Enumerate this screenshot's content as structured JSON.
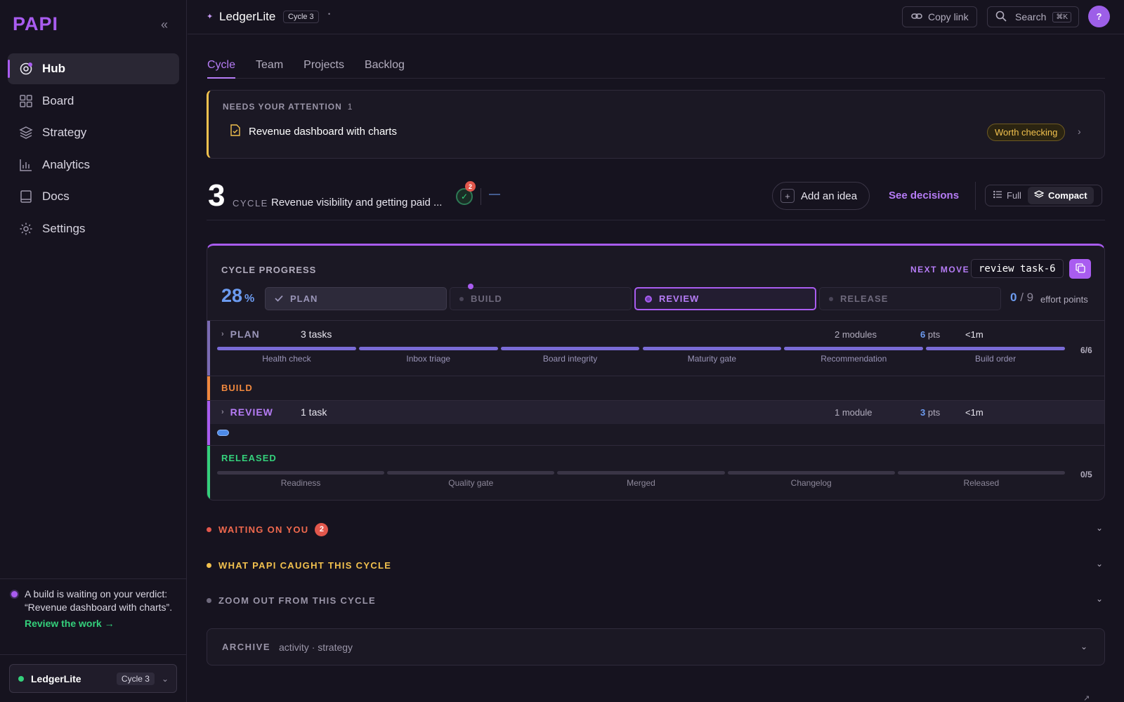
{
  "sidebar": {
    "logo": "PAPI",
    "items": [
      {
        "label": "Hub",
        "icon": "hub-icon",
        "active": true
      },
      {
        "label": "Board",
        "icon": "grid-icon"
      },
      {
        "label": "Strategy",
        "icon": "layers-icon"
      },
      {
        "label": "Analytics",
        "icon": "bar-chart-icon"
      },
      {
        "label": "Docs",
        "icon": "book-icon"
      },
      {
        "label": "Settings",
        "icon": "gear-icon"
      }
    ],
    "notice": {
      "text": "A build is waiting on your verdict: “Revenue dashboard with charts”.",
      "link": "Review the work →"
    },
    "project": {
      "name": "LedgerLite",
      "cycle": "Cycle 3"
    }
  },
  "topbar": {
    "project": "LedgerLite",
    "cycle": "Cycle 3",
    "copy_link": "Copy link",
    "search": "Search",
    "search_shortcut": "⌘K",
    "help": "?"
  },
  "tabs": [
    "Cycle",
    "Team",
    "Projects",
    "Backlog"
  ],
  "attention": {
    "label": "NEEDS YOUR ATTENTION",
    "count": "1",
    "item": "Revenue dashboard with charts",
    "badge": "Worth checking"
  },
  "cycle": {
    "number": "3",
    "word": "CYCLE",
    "name": "Revenue visibility and getting paid ...",
    "check_badge": "2",
    "dash": "—",
    "add_idea": "Add an idea",
    "see_decisions": "See decisions",
    "view_full": "Full",
    "view_compact": "Compact"
  },
  "progress": {
    "title": "CYCLE PROGRESS",
    "next_move_label": "NEXT MOVE",
    "next_move_cmd": "review task-6",
    "percent": "28",
    "percent_sign": "%",
    "percent_value": 28,
    "stages": [
      "PLAN",
      "BUILD",
      "REVIEW",
      "RELEASE"
    ],
    "effort_done": "0",
    "effort_total": "/ 9",
    "effort_label": "effort points",
    "plan": {
      "name": "PLAN",
      "tasks": "3 tasks",
      "modules": "2 modules",
      "pts": "6",
      "pts_unit": "pts",
      "time": "<1m",
      "count": "6/6",
      "steps": [
        "Health check",
        "Inbox triage",
        "Board integrity",
        "Maturity gate",
        "Recommendation",
        "Build order"
      ],
      "steps_done": 6
    },
    "build": {
      "name": "BUILD"
    },
    "review": {
      "name": "REVIEW",
      "tasks": "1 task",
      "modules": "1 module",
      "pts": "3",
      "pts_unit": "pts",
      "time": "<1m"
    },
    "released": {
      "name": "RELEASED",
      "count": "0/5",
      "steps": [
        "Readiness",
        "Quality gate",
        "Merged",
        "Changelog",
        "Released"
      ],
      "steps_done": 0
    }
  },
  "sections": {
    "waiting": {
      "title": "WAITING ON YOU",
      "badge": "2"
    },
    "caught": {
      "title": "WHAT PAPI CAUGHT THIS CYCLE"
    },
    "zoom": {
      "title": "ZOOM OUT FROM THIS CYCLE"
    },
    "archive": {
      "title": "ARCHIVE",
      "sub": "activity · strategy"
    }
  },
  "colors": {
    "accent": "#a95cf0",
    "blue": "#6c9bf0",
    "green": "#34d07b",
    "orange": "#f0883e",
    "red": "#e2574c",
    "yellow": "#f2c14e"
  }
}
